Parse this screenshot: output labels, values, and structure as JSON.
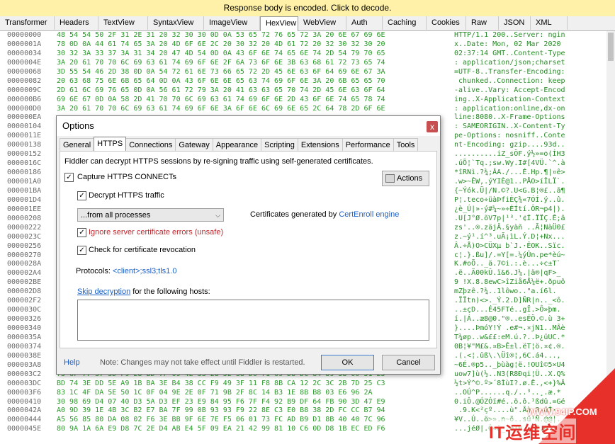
{
  "banner": {
    "text": "Response body is encoded. Click to decode."
  },
  "inspector_tabs": [
    {
      "label": "Transformer",
      "w": 77
    },
    {
      "label": "Headers",
      "w": 62
    },
    {
      "label": "TextView",
      "w": 70
    },
    {
      "label": "SyntaxView",
      "w": 79
    },
    {
      "label": "ImageView",
      "w": 79
    },
    {
      "label": "HexView",
      "w": 54,
      "active": true
    },
    {
      "label": "WebView",
      "w": 68
    },
    {
      "label": "Auth",
      "w": 51
    },
    {
      "label": "Caching",
      "w": 62
    },
    {
      "label": "Cookies",
      "w": 56
    },
    {
      "label": "Raw",
      "w": 46
    },
    {
      "label": "JSON",
      "w": 45
    },
    {
      "label": "XML",
      "w": 52
    }
  ],
  "hex": {
    "rows": [
      {
        "addr": "00000000",
        "bytes": "48 54 54 50 2F 31 2E 31 20 32 30 30 0D 0A 53 65 72 76 65 72 3A 20 6E 67 69 6E",
        "ascii": "HTTP/1.1 200..Server: ngin"
      },
      {
        "addr": "0000001A",
        "bytes": "78 0D 0A 44 61 74 65 3A 20 4D 6F 6E 2C 20 30 32 20 4D 61 72 20 32 30 32 30 20",
        "ascii": "x..Date: Mon, 02 Mar 2020 "
      },
      {
        "addr": "00000034",
        "bytes": "30 32 3A 33 37 3A 31 34 20 47 4D 54 0D 0A 43 6F 6E 74 65 6E 74 2D 54 79 70 65",
        "ascii": "02:37:14 GMT..Content-Type"
      },
      {
        "addr": "0000004E",
        "bytes": "3A 20 61 70 70 6C 69 63 61 74 69 6F 6E 2F 6A 73 6F 6E 3B 63 68 61 72 73 65 74",
        "ascii": ": application/json;charset"
      },
      {
        "addr": "00000068",
        "bytes": "3D 55 54 46 2D 38 0D 0A 54 72 61 6E 73 66 65 72 2D 45 6E 63 6F 64 69 6E 67 3A",
        "ascii": "=UTF-8..Transfer-Encoding:"
      },
      {
        "addr": "00000082",
        "bytes": "20 63 68 75 6E 6B 65 64 0D 0A 43 6F 6E 6E 65 63 74 69 6F 6E 3A 20 6B 65 65 70",
        "ascii": " chunked..Connection: keep"
      },
      {
        "addr": "0000009C",
        "bytes": "2D 61 6C 69 76 65 0D 0A 56 61 72 79 3A 20 41 63 63 65 70 74 2D 45 6E 63 6F 64",
        "ascii": "-alive..Vary: Accept-Encod"
      },
      {
        "addr": "000000B6",
        "bytes": "69 6E 67 0D 0A 58 2D 41 70 70 6C 69 63 61 74 69 6F 6E 2D 43 6F 6E 74 65 78 74",
        "ascii": "ing..X-Application-Context"
      },
      {
        "addr": "000000D0",
        "bytes": "3A 20 61 70 70 6C 69 63 61 74 69 6F 6E 3A 6F 6E 6C 69 6E 65 2C 64 78 2D 6F 6E",
        "ascii": ": application:online,dx-on"
      },
      {
        "addr": "000000EA",
        "bytes": "",
        "ascii": "line:8080..X-Frame-Options"
      },
      {
        "addr": "00000104",
        "bytes": "",
        "ascii": ": SAMEORIGIN..X-Content-Ty"
      },
      {
        "addr": "0000011E",
        "bytes": "",
        "ascii": "pe-Options: nosniff..Conte"
      },
      {
        "addr": "00000138",
        "bytes": "",
        "ascii": "nt-Encoding: gzip....93d.."
      },
      {
        "addr": "00000152",
        "bytes": "",
        "ascii": "..........iZ_sÖF.ý½»=o(ÍH3"
      },
      {
        "addr": "0000016C",
        "bytes": "",
        "ascii": ".úÕ¦`Tq.;sw.Wy.I#[4VÜ.`^.à"
      },
      {
        "addr": "00000186",
        "bytes": "",
        "ascii": "*îRNì.?¾;ÂA./...É.Hp.¶|¤ê>"
      },
      {
        "addr": "000001A0",
        "bytes": "",
        "ascii": ".w>~ÊW,.ýYIÈ@1..PÅO>íÎLÏ`."
      },
      {
        "addr": "000001BA",
        "bytes": "",
        "ascii": "{~Ýók.Ü|/N.©?.U<G.B¦®£..ã¶"
      },
      {
        "addr": "000001D4",
        "bytes": "",
        "ascii": "P¦.teco÷üàÞfiÈÇ¾«7ÓÍ.ý..û."
      },
      {
        "addr": "000001EE",
        "bytes": "",
        "ascii": "¿è_Ú|»·ý#¼~»÷ÈÍtí.ÔR¬p4|)."
      },
      {
        "addr": "00000208",
        "bytes": "",
        "ascii": ".U[J°Ø.õV7p|¹³.'¢Í.ÏÏÇ.Ê;ã"
      },
      {
        "addr": "00000222",
        "bytes": "",
        "ascii": "zs'..®.zäjÂ.§yàñ ..Ã¦NàÜ0£"
      },
      {
        "addr": "0000023C",
        "bytes": "",
        "ascii": "z.~ý¹.í^³.uÃ¡ìL.Ý.D¦+Nx..."
      },
      {
        "addr": "00000256",
        "bytes": "",
        "ascii": "Â.÷Å)O>CÜXµ b`J.·ÊOK..Sïc."
      },
      {
        "addr": "00000270",
        "bytes": "",
        "ascii": "c¦.}.ßu]/.=Y[=.¼ýÛn.pe*èú~"
      },
      {
        "addr": "0000028A",
        "bytes": "",
        "ascii": "K.#oÕ.._ä.7©i.:.è...÷c±T`"
      },
      {
        "addr": "000002A4",
        "bytes": "",
        "ascii": ".ë..Ä00kÛ.ï&6.J¼.|ä®|qF>_"
      },
      {
        "addr": "000002BE",
        "bytes": "",
        "ascii": "9 !X.8.8ewC>îZiå6Å¼ë+.ðpuô"
      },
      {
        "addr": "000002D8",
        "bytes": "",
        "ascii": "mZþzê.?¾..1lôwo..\"a.í6l."
      },
      {
        "addr": "000002F2",
        "bytes": "",
        "ascii": ".ÏÏtn)<>._Ý.2.D]ÑR|n.._<ô."
      },
      {
        "addr": "0000030C",
        "bytes": "",
        "ascii": "..±çD...É45FTé..gÏ.>Ô»þm."
      },
      {
        "addr": "00000326",
        "bytes": "",
        "ascii": "í.|Á..æ8@0.\"®..esÉÖ.©.ù 3+"
      },
      {
        "addr": "00000340",
        "bytes": "",
        "ascii": "}....ÞmóY!Ý .e#¬.¤jN1..MÂè"
      },
      {
        "addr": "0000035A",
        "bytes": "",
        "ascii": "T¾øp..w&££:eM.ú.?..Þ¿üUC.*"
      },
      {
        "addr": "00000374",
        "bytes": "",
        "ascii": "0B¦¥\"M£&.¤B>Ê±l.ëT¦ö.¤¢.®."
      },
      {
        "addr": "0000038E",
        "bytes": "",
        "ascii": ".(.<¦.ûß\\.\\Üî®¦,6C.á4...,"
      },
      {
        "addr": "000003A8",
        "bytes": "",
        "ascii": "~6É.®p5.._þùàg¦ë.!OUî©5×U4"
      },
      {
        "addr": "000003C2",
        "bytes": "75 6F 77 37 5D F9 28 BD 7F 09 4E 33 28 52 38 D0 71 69 D8 DC 84 89 58 00 51 25",
        "ascii": "uow7]ù(½..N3(R8Ðqi¦Ü..X.Q%"
      },
      {
        "addr": "000003DC",
        "bytes": "BD 74 3E DD 5E A9 1B BA 3E B4 38 CC F9 49 3F 11 F8 8B CA 12 2C 3C 2B 7D 25 C3",
        "ascii": "½t>Ý^©.º>´8ÌùI?.ø.Ê.,<+}%Ã"
      },
      {
        "addr": "000003F6",
        "bytes": "83 1C 4F DA 5E 50 1C 0F 04 9E 2E 0F 71 9B 2F 8C 14 B3 1E 8B B8 03 E6 96 2A",
        "ascii": "..OÚ^P......q./..³..¸.æ.*"
      },
      {
        "addr": "00000410",
        "bytes": "30 98 69 D4 07 40 D3 5A D3 EF 23 E9 84 95 F6 7F F4 92 B9 DF 64 FB 90 3D 47 E9",
        "ascii": "0.iÔ.@ÓZÓï#é..ö.ô.¹ßdû.=Gé"
      },
      {
        "addr": "0000042A",
        "bytes": "A0 9D 39 1E 4B 3C B2 E7 BA 7F 99 0B 93 93 F9 22 8E C3 E0 B8 38 2D FC CC B7 94",
        "ascii": " .9.K<²çº....ù\".Ãà¸8-üÌ·."
      },
      {
        "addr": "00000444",
        "bytes": "A5 56 85 80 DA 08 02 F6 3E BB 9F 6E 7E F5 06 01 73 FC AD B9 D1 8B 40 40 7C 96",
        "ascii": "¥V..Ú..ö>».n~õ..sü­¹Ñ.@@|."
      },
      {
        "addr": "0000045E",
        "bytes": "80 9A 1A 6A E9 D8 7C 2E D4 AB E4 5F 09 EA 21 42 99 81 10 C6 0D D8 1B EC ED F6",
        "ascii": "...jéØ|.Ô«ä_.ê!B...Æ.Ø.ìíö"
      }
    ]
  },
  "dialog": {
    "title": "Options",
    "close_glyph": "x",
    "tabs": [
      "General",
      "HTTPS",
      "Connections",
      "Gateway",
      "Appearance",
      "Scripting",
      "Extensions",
      "Performance",
      "Tools"
    ],
    "active_tab": "HTTPS",
    "description": "Fiddler can decrypt HTTPS sessions by re-signing traffic using self-generated certificates.",
    "capture_label": "Capture HTTPS CONNECTs",
    "capture_checked": true,
    "decrypt_label": "Decrypt HTTPS traffic",
    "decrypt_checked": true,
    "process_select": "...from all processes",
    "ignore_label": "Ignore server certificate errors (unsafe)",
    "ignore_checked": true,
    "revocation_label": "Check for certificate revocation",
    "revocation_checked": true,
    "actions_label": "Actions",
    "cert_text": "Certificates generated by",
    "cert_link": "CertEnroll engine",
    "protocols_label": "Protocols:",
    "protocols_value": "<client>;ssl3;tls1.0",
    "skip_link": "Skip decryption",
    "skip_rest": "for the following hosts:",
    "help_label": "Help",
    "note": "Note: Changes may not take effect until Fiddler is restarted.",
    "ok_label": "OK",
    "cancel_label": "Cancel"
  },
  "watermark": {
    "url": "WWW.94IP.COM",
    "brand": "IT运维空间"
  },
  "colors": {
    "banner_bg": "#fff2a8",
    "hex_green": "#2a9a2a",
    "link_blue": "#1a5fc7",
    "warning_red": "#c1272d",
    "watermark_red": "#e8302a"
  }
}
